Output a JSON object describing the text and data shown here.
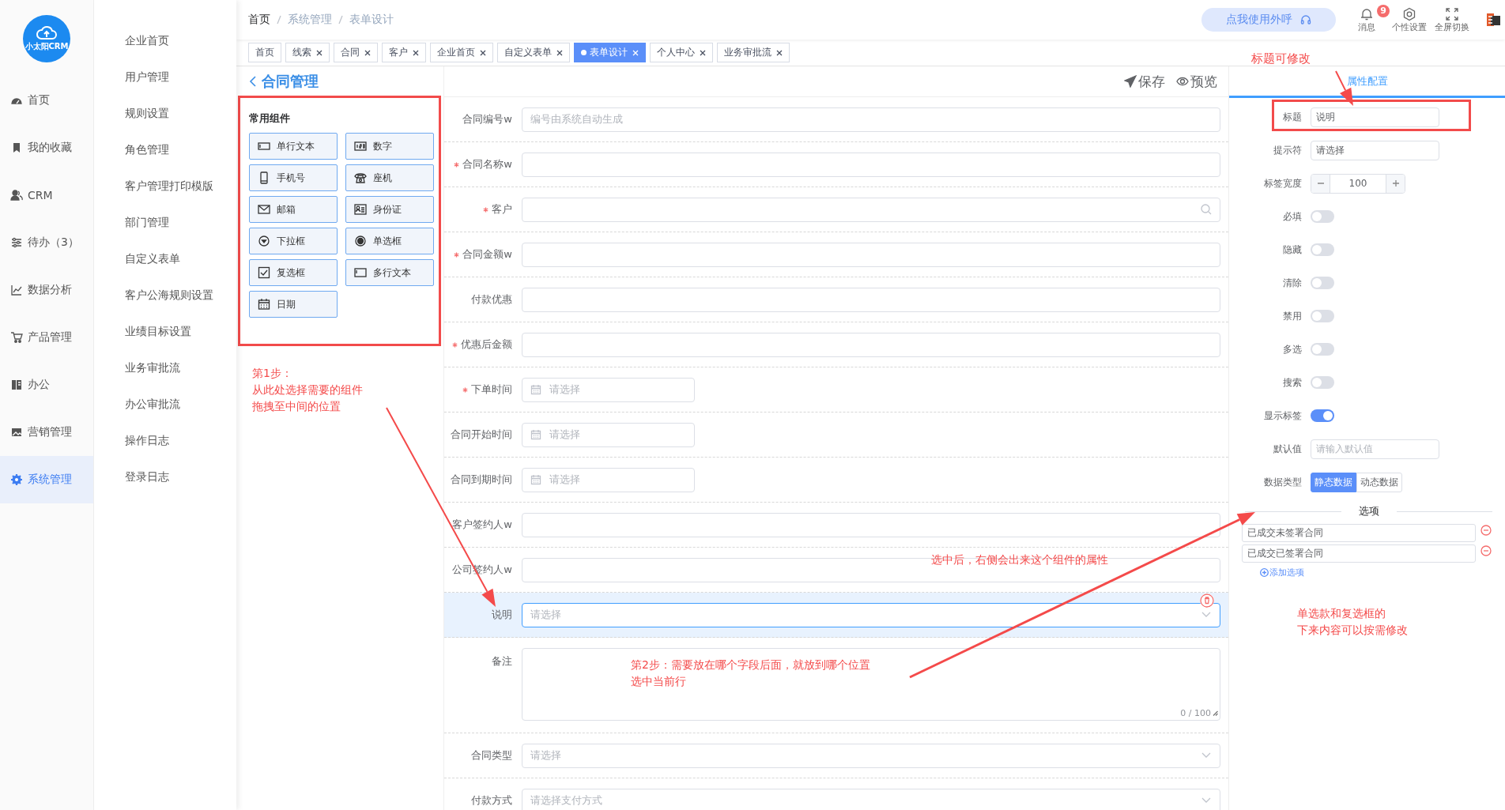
{
  "logo": {
    "text": "小太阳CRM"
  },
  "nav": [
    {
      "label": "首页",
      "selected": false
    },
    {
      "label": "我的收藏",
      "selected": false
    },
    {
      "label": "CRM",
      "selected": false
    },
    {
      "label": "待办（3）",
      "selected": false
    },
    {
      "label": "数据分析",
      "selected": false
    },
    {
      "label": "产品管理",
      "selected": false
    },
    {
      "label": "办公",
      "selected": false
    },
    {
      "label": "营销管理",
      "selected": false
    },
    {
      "label": "系统管理",
      "selected": true
    }
  ],
  "submenu": [
    "企业首页",
    "用户管理",
    "规则设置",
    "角色管理",
    "客户管理打印模版",
    "部门管理",
    "自定义表单",
    "客户公海规则设置",
    "业绩目标设置",
    "业务审批流",
    "办公审批流",
    "操作日志",
    "登录日志"
  ],
  "breadcrumb": [
    "首页",
    "系统管理",
    "表单设计"
  ],
  "header": {
    "call_button": "点我使用外呼",
    "actions": [
      {
        "label": "消息",
        "badge": "9"
      },
      {
        "label": "个性设置"
      },
      {
        "label": "全屏切换"
      }
    ]
  },
  "tabs": [
    {
      "label": "首页",
      "closable": false,
      "selected": false
    },
    {
      "label": "线索",
      "closable": true,
      "selected": false
    },
    {
      "label": "合同",
      "closable": true,
      "selected": false
    },
    {
      "label": "客户",
      "closable": true,
      "selected": false
    },
    {
      "label": "企业首页",
      "closable": true,
      "selected": false
    },
    {
      "label": "自定义表单",
      "closable": true,
      "selected": false
    },
    {
      "label": "表单设计",
      "closable": true,
      "selected": true
    },
    {
      "label": "个人中心",
      "closable": true,
      "selected": false
    },
    {
      "label": "业务审批流",
      "closable": true,
      "selected": false
    }
  ],
  "page_title": "合同管理",
  "toolbar": [
    {
      "label": "保存"
    },
    {
      "label": "预览"
    }
  ],
  "components": {
    "title": "常用组件",
    "items": [
      "单行文本",
      "数字",
      "手机号",
      "座机",
      "邮箱",
      "身份证",
      "下拉框",
      "单选框",
      "复选框",
      "多行文本",
      "日期"
    ]
  },
  "form": {
    "rows": [
      {
        "label": "合同编号w",
        "kind": "text",
        "required": false,
        "selected": false,
        "placeholder": "编号由系统自动生成"
      },
      {
        "label": "合同名称w",
        "kind": "text",
        "required": true,
        "selected": false
      },
      {
        "label": "客户",
        "kind": "search",
        "required": true,
        "selected": false
      },
      {
        "label": "合同金额w",
        "kind": "text",
        "required": true,
        "selected": false
      },
      {
        "label": "付款优惠",
        "kind": "text",
        "required": false,
        "selected": false
      },
      {
        "label": "优惠后金额",
        "kind": "text",
        "required": true,
        "selected": false
      },
      {
        "label": "下单时间",
        "kind": "date",
        "required": true,
        "selected": false,
        "placeholder": "请选择"
      },
      {
        "label": "合同开始时间",
        "kind": "date",
        "required": false,
        "selected": false,
        "placeholder": "请选择"
      },
      {
        "label": "合同到期时间",
        "kind": "date",
        "required": false,
        "selected": false,
        "placeholder": "请选择"
      },
      {
        "label": "客户签约人w",
        "kind": "text",
        "required": false,
        "selected": false
      },
      {
        "label": "公司签约人w",
        "kind": "text",
        "required": false,
        "selected": false
      },
      {
        "label": "说明",
        "kind": "select",
        "required": false,
        "selected": true,
        "placeholder": "请选择"
      },
      {
        "label": "备注",
        "kind": "textarea",
        "required": false,
        "selected": false,
        "counter": "0 / 100"
      },
      {
        "label": "合同类型",
        "kind": "select",
        "required": false,
        "selected": false,
        "placeholder": "请选择"
      },
      {
        "label": "付款方式",
        "kind": "select",
        "required": false,
        "selected": false,
        "placeholder": "请选择支付方式"
      }
    ]
  },
  "properties": {
    "tab": "属性配置",
    "fields": [
      {
        "kind": "input",
        "label": "标题",
        "value": "说明"
      },
      {
        "kind": "input",
        "label": "提示符",
        "value": "请选择"
      },
      {
        "kind": "number",
        "label": "标签宽度",
        "value": "100"
      },
      {
        "kind": "switch",
        "label": "必填",
        "on": false
      },
      {
        "kind": "switch",
        "label": "隐藏",
        "on": false
      },
      {
        "kind": "switch",
        "label": "清除",
        "on": false
      },
      {
        "kind": "switch",
        "label": "禁用",
        "on": false
      },
      {
        "kind": "switch",
        "label": "多选",
        "on": false
      },
      {
        "kind": "switch",
        "label": "搜索",
        "on": false
      },
      {
        "kind": "switch",
        "label": "显示标签",
        "on": true
      },
      {
        "kind": "input",
        "label": "默认值",
        "placeholder": "请输入默认值"
      },
      {
        "kind": "segmented",
        "label": "数据类型",
        "options": [
          {
            "label": "静态数据",
            "selected": true
          },
          {
            "label": "动态数据",
            "selected": false
          }
        ]
      }
    ],
    "options_title": "选项",
    "options": [
      "已成交未签署合同",
      "已成交已签署合同"
    ],
    "add_option": "添加选项"
  },
  "annotations": [
    {
      "lines": [
        "标题可修改"
      ]
    },
    {
      "lines": [
        "第1步：",
        "从此处选择需要的组件",
        "拖拽至中间的位置"
      ]
    },
    {
      "lines": [
        "选中后，右侧会出来这个组件的属性"
      ]
    },
    {
      "lines": [
        "第2步：需要放在哪个字段后面，就放到哪个位置",
        "选中当前行"
      ]
    },
    {
      "lines": [
        "单选款和复选框的",
        "下来内容可以按需修改"
      ]
    }
  ]
}
